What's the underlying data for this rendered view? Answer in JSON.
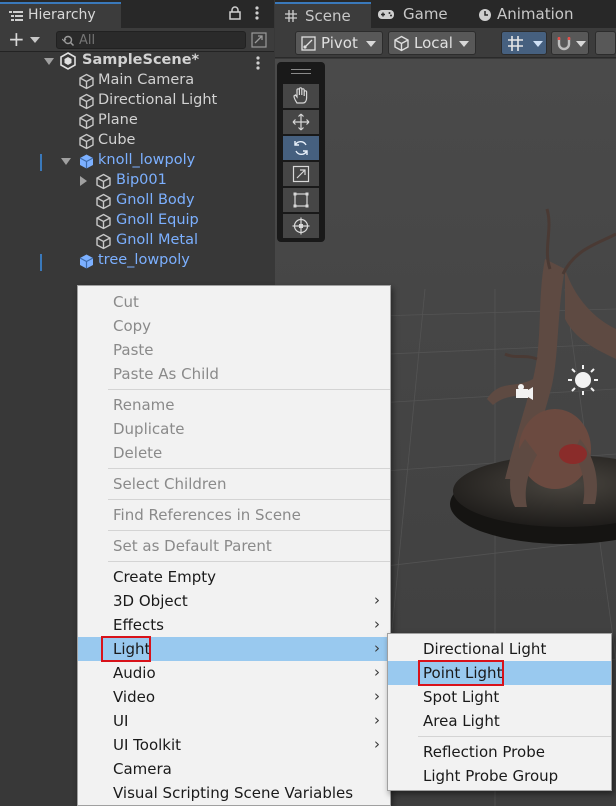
{
  "hierarchy": {
    "tab_label": "Hierarchy",
    "search_placeholder": "All",
    "add_label": "+",
    "scene_name": "SampleScene*",
    "items": [
      {
        "label": "Main Camera"
      },
      {
        "label": "Directional Light"
      },
      {
        "label": "Plane"
      },
      {
        "label": "Cube"
      },
      {
        "label": "knoll_lowpoly"
      },
      {
        "label": "Bip001"
      },
      {
        "label": "Gnoll Body"
      },
      {
        "label": "Gnoll Equip"
      },
      {
        "label": "Gnoll Metal"
      },
      {
        "label": "tree_lowpoly"
      }
    ]
  },
  "scene_view": {
    "tabs": [
      {
        "label": "Scene",
        "icon": "grid-icon"
      },
      {
        "label": "Game",
        "icon": "gamepad-icon"
      },
      {
        "label": "Animation",
        "icon": "clock-icon"
      }
    ],
    "pivot_label": "Pivot",
    "local_label": "Local",
    "tools": [
      "hand-tool",
      "move-tool",
      "rotate-tool",
      "scale-tool",
      "rect-tool",
      "transform-tool"
    ],
    "active_tool": "rotate-tool"
  },
  "context_menu": {
    "groups": [
      [
        {
          "label": "Cut",
          "enabled": false
        },
        {
          "label": "Copy",
          "enabled": false
        },
        {
          "label": "Paste",
          "enabled": false
        },
        {
          "label": "Paste As Child",
          "enabled": false
        }
      ],
      [
        {
          "label": "Rename",
          "enabled": false
        },
        {
          "label": "Duplicate",
          "enabled": false
        },
        {
          "label": "Delete",
          "enabled": false
        }
      ],
      [
        {
          "label": "Select Children",
          "enabled": false
        }
      ],
      [
        {
          "label": "Find References in Scene",
          "enabled": false
        }
      ],
      [
        {
          "label": "Set as Default Parent",
          "enabled": false
        }
      ],
      [
        {
          "label": "Create Empty",
          "enabled": true
        },
        {
          "label": "3D Object",
          "enabled": true,
          "submenu": true
        },
        {
          "label": "Effects",
          "enabled": true,
          "submenu": true
        },
        {
          "label": "Light",
          "enabled": true,
          "submenu": true,
          "highlighted": true
        },
        {
          "label": "Audio",
          "enabled": true,
          "submenu": true
        },
        {
          "label": "Video",
          "enabled": true,
          "submenu": true
        },
        {
          "label": "UI",
          "enabled": true,
          "submenu": true
        },
        {
          "label": "UI Toolkit",
          "enabled": true,
          "submenu": true
        },
        {
          "label": "Camera",
          "enabled": true
        },
        {
          "label": "Visual Scripting Scene Variables",
          "enabled": true
        }
      ]
    ],
    "submenu_arrow": "›"
  },
  "light_submenu": {
    "items": [
      {
        "label": "Directional Light"
      },
      {
        "label": "Point Light",
        "highlighted": true
      },
      {
        "label": "Spot Light"
      },
      {
        "label": "Area Light"
      },
      {
        "label": "Reflection Probe"
      },
      {
        "label": "Light Probe Group"
      }
    ]
  },
  "colors": {
    "highlight": "#99c9ef",
    "annotation_box": "#d8121a",
    "prefab_blue": "#7cb0ff",
    "accent": "#3a79bb"
  }
}
